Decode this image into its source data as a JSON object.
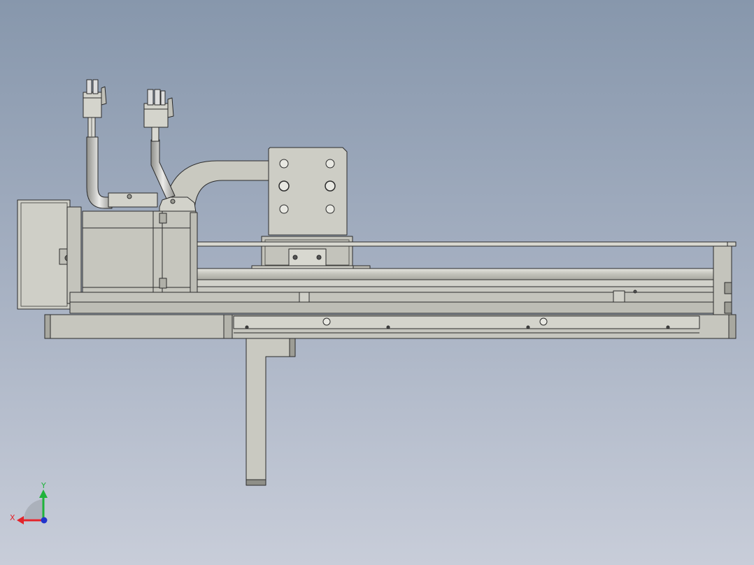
{
  "viewport": {
    "background_top": "#8797ac",
    "background_bottom": "#c8cdd9",
    "part_fill": "#c9c9c0",
    "part_fill_dark": "#b7b7ae",
    "part_fill_light": "#dcdcd4",
    "edge_color": "#2b2b2b"
  },
  "triad": {
    "x_label": "X",
    "y_label": "Y",
    "x_color": "#e3232a",
    "y_color": "#1fb33b",
    "z_color": "#2233cc"
  }
}
